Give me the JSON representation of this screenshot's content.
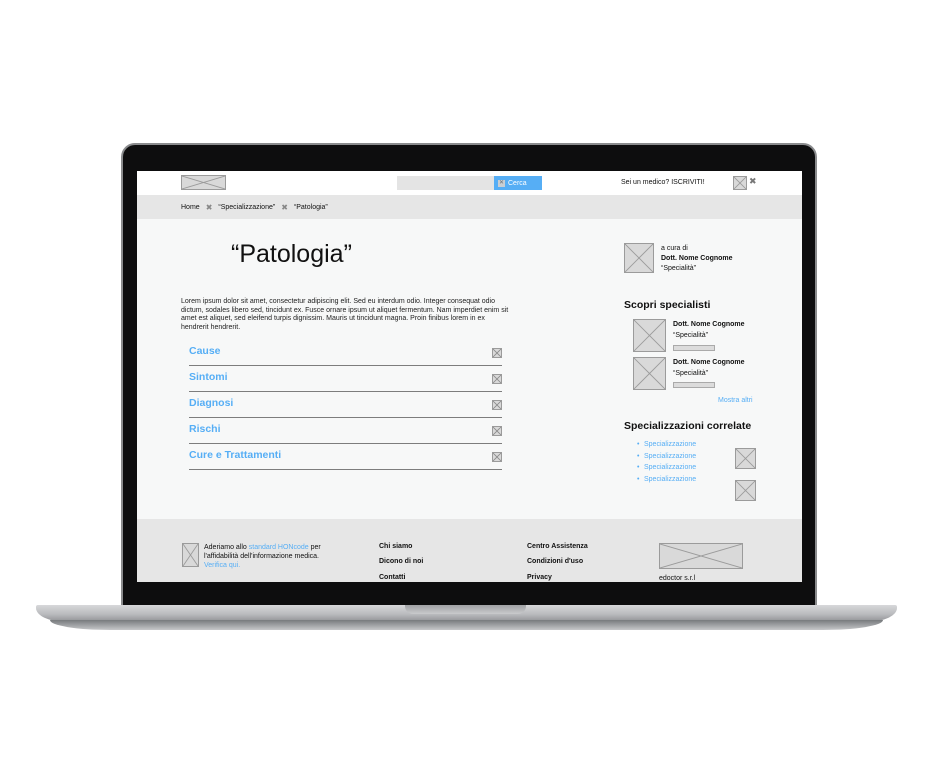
{
  "header": {
    "search_button_label": "Cerca",
    "search_placeholder": "",
    "cta": "Sei un medico? ISCRIVITI!"
  },
  "breadcrumb": [
    "Home",
    "“Specializzazione”",
    "“Patologia”"
  ],
  "main": {
    "title": "“Patologia”",
    "intro": "Lorem ipsum dolor sit amet, consectetur adipiscing elit. Sed eu interdum odio. Integer consequat odio dictum, sodales libero sed, tincidunt ex. Fusce ornare ipsum ut aliquet fermentum. Nam imperdiet enim sit amet est aliquet, sed eleifend turpis dignissim. Mauris ut tincidunt magna. Proin finibus lorem in ex hendrerit hendrerit.",
    "accordion": [
      "Cause",
      "Sintomi",
      "Diagnosi",
      "Rischi",
      "Cure e Trattamenti"
    ]
  },
  "sidebar": {
    "author_prefix": "a cura di",
    "author_name": "Dott. Nome Cognome",
    "author_spec": "“Specialità”",
    "specialists_title": "Scopri specialisti",
    "specialists": [
      {
        "name": "Dott. Nome Cognome",
        "spec": "“Specialità”"
      },
      {
        "name": "Dott. Nome Cognome",
        "spec": "“Specialità”"
      }
    ],
    "show_more": "Mostra altri",
    "related_title": "Specializzazioni correlate",
    "related": [
      "Specializzazione",
      "Specializzazione",
      "Specializzazione",
      "Specializzazione"
    ]
  },
  "footer": {
    "hon_text_1": "Aderiamo allo ",
    "hon_link": "standard HONcode",
    "hon_text_2": " per l'affidabilità dell'informazione medica. ",
    "hon_verify": "Verifica qui.",
    "col1": [
      "Chi siamo",
      "Dicono di noi",
      "Contatti"
    ],
    "col2": [
      "Centro Assistenza",
      "Condizioni d'uso",
      "Privacy"
    ],
    "company": "edoctor s.r.l"
  },
  "colors": {
    "accent": "#56aef5",
    "bar": "#e6e6e6",
    "text": "#111111"
  }
}
